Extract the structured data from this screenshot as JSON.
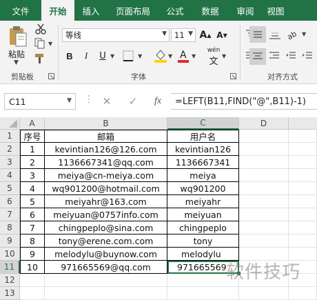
{
  "ribbon": {
    "tabs": [
      "文件",
      "开始",
      "插入",
      "页面布局",
      "公式",
      "数据",
      "审阅",
      "视图"
    ],
    "active_tab": "开始",
    "groups": {
      "clipboard": "剪贴板",
      "font": "字体",
      "alignment": "对齐方式"
    },
    "paste_label": "粘贴",
    "font_name": "等线",
    "font_size": "11",
    "wen_label": "wén"
  },
  "formula_bar": {
    "cell_ref": "C11",
    "fx": "fx",
    "formula": "=LEFT(B11,FIND(\"@\",B11)-1)"
  },
  "sheet": {
    "columns": [
      "A",
      "B",
      "C",
      "D"
    ],
    "rows": [
      "1",
      "2",
      "3",
      "4",
      "5",
      "6",
      "7",
      "8",
      "9",
      "10",
      "11",
      "12",
      "13"
    ],
    "header_row": [
      "序号",
      "邮箱",
      "用户名"
    ],
    "data": [
      [
        "1",
        "kevintian126@126.com",
        "kevintian126"
      ],
      [
        "2",
        "1136667341@qq.com",
        "1136667341"
      ],
      [
        "3",
        "meiya@cn-meiya.com",
        "meiya"
      ],
      [
        "4",
        "wq901200@hotmail.com",
        "wq901200"
      ],
      [
        "5",
        "meiyahr@163.com",
        "meiyahr"
      ],
      [
        "6",
        "meiyuan@0757info.com",
        "meiyuan"
      ],
      [
        "7",
        "chingpeplo@sina.com",
        "chingpeplo"
      ],
      [
        "8",
        "tony@erene.com.com",
        "tony"
      ],
      [
        "9",
        "melodylu@buynow.com",
        "melodylu"
      ],
      [
        "10",
        "971665569@qq.com",
        "971665569"
      ]
    ],
    "active_cell": "C11"
  },
  "watermark": "软件技巧",
  "colors": {
    "accent": "#217346"
  }
}
